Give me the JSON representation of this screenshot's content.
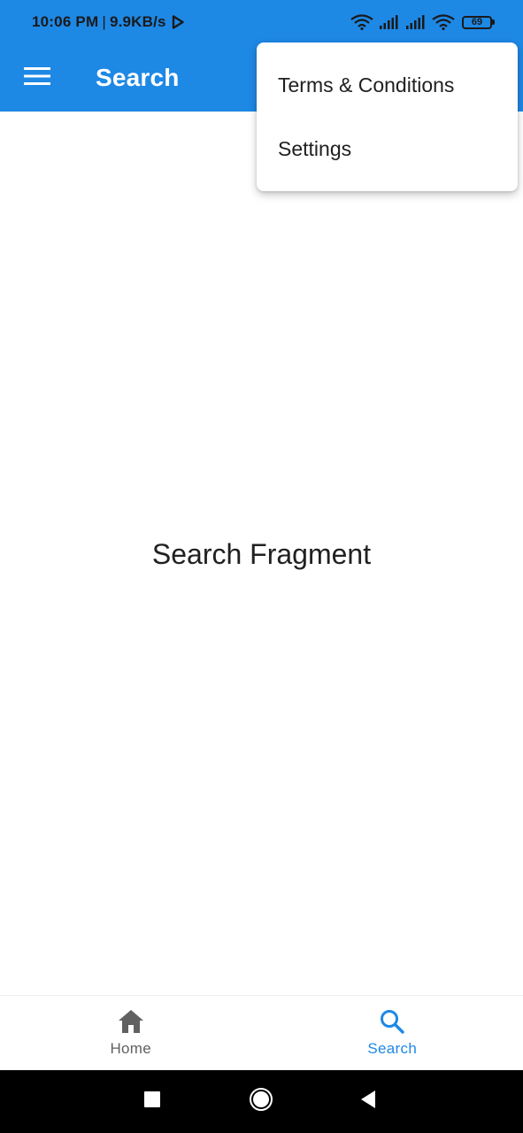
{
  "status_bar": {
    "time": "10:06 PM",
    "separator": "|",
    "network_speed": "9.9KB/s",
    "battery_level": "69",
    "icons": [
      "play-store-icon",
      "wifi-icon",
      "signal-icon",
      "signal-icon",
      "wifi-icon",
      "battery-icon"
    ]
  },
  "toolbar": {
    "title": "Search",
    "menu_icon": "hamburger-menu-icon"
  },
  "popup_menu": {
    "items": [
      {
        "label": "Terms & Conditions"
      },
      {
        "label": "Settings"
      }
    ]
  },
  "content": {
    "text": "Search Fragment"
  },
  "bottom_nav": {
    "items": [
      {
        "label": "Home",
        "icon": "home-icon",
        "active": false
      },
      {
        "label": "Search",
        "icon": "search-icon",
        "active": true
      }
    ]
  },
  "system_nav": {
    "buttons": [
      "recents-icon",
      "home-circle-icon",
      "back-icon"
    ]
  },
  "colors": {
    "primary": "#1e88e5",
    "inactive": "#616161",
    "background": "#ffffff"
  }
}
